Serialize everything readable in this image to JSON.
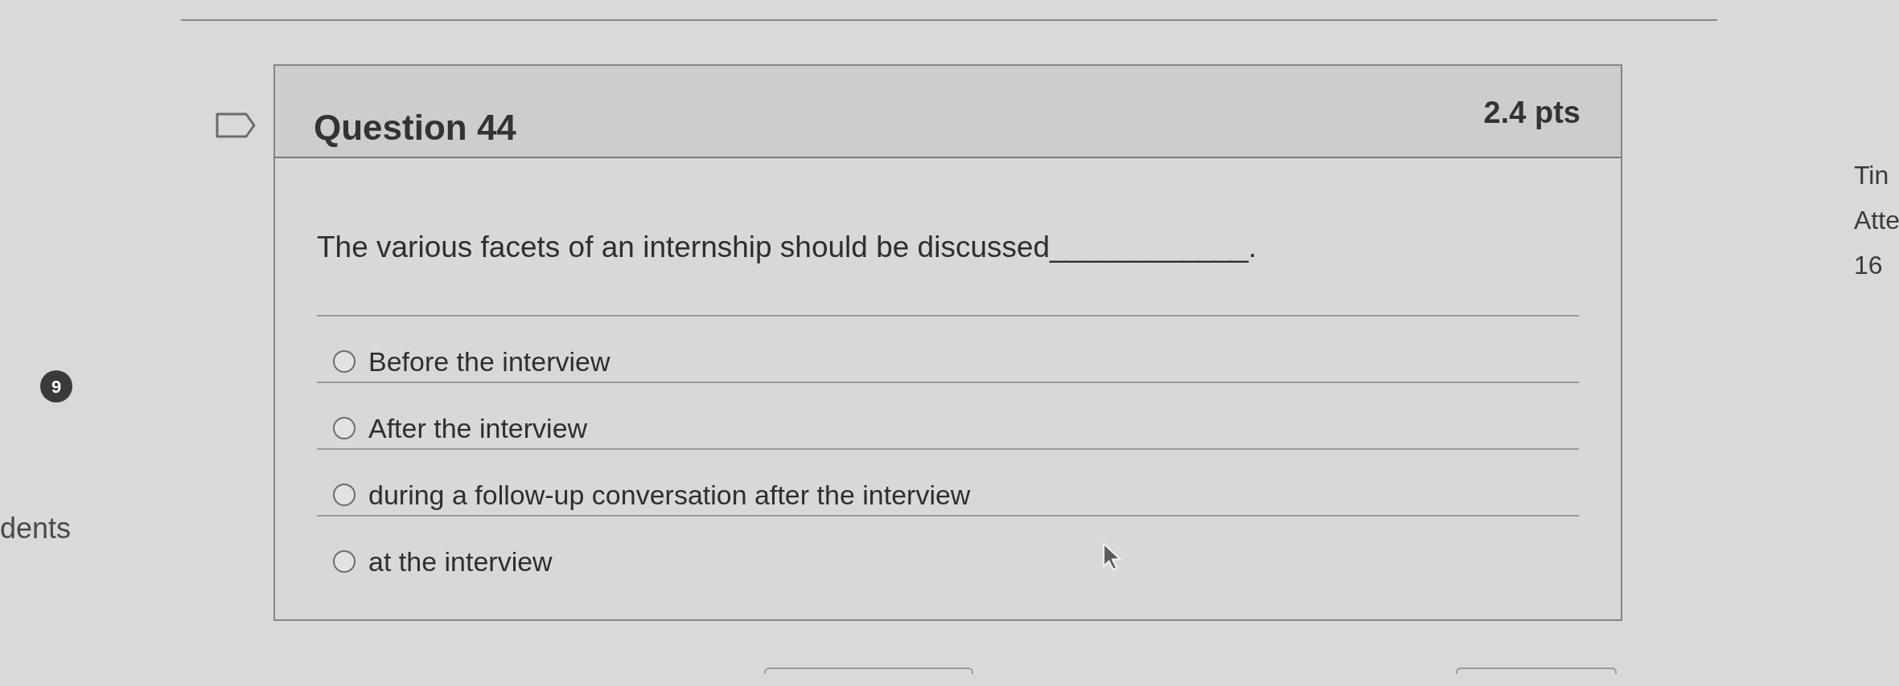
{
  "left_panel": {
    "badge": "9",
    "partial_label": "dents"
  },
  "question": {
    "title": "Question 44",
    "points": "2.4 pts",
    "text": "The various facets of an internship should be discussed____________.",
    "options": [
      {
        "label": "Before the interview",
        "selected": false
      },
      {
        "label": "After the interview",
        "selected": false
      },
      {
        "label": "during a follow-up conversation after the interview",
        "selected": false
      },
      {
        "label": "at the interview",
        "selected": false
      }
    ]
  },
  "right_panel": {
    "lines": [
      "Tin",
      "Atte",
      "16"
    ]
  }
}
